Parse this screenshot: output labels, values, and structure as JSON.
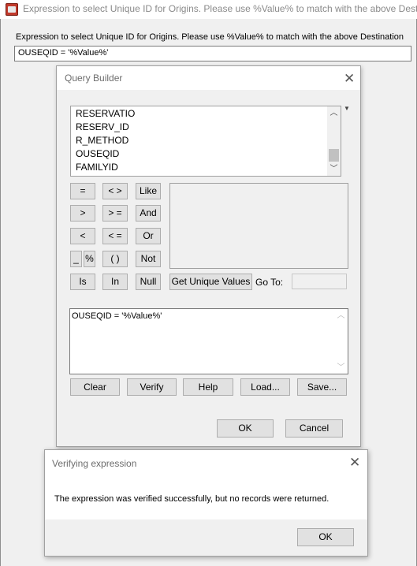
{
  "window": {
    "title": "Expression to select Unique ID for Origins.  Please use %Value% to match with the above Destin",
    "expression_label": "Expression to select Unique ID for Origins.  Please use %Value% to match with the above Destination",
    "expression_value": "OUSEQID = '%Value%'"
  },
  "query_builder": {
    "title": "Query Builder",
    "close_glyph": "✕",
    "fields": [
      "RESERVATIO",
      "RESERV_ID",
      "R_METHOD",
      "OUSEQID",
      "FAMILYID"
    ],
    "operators": {
      "eq": "=",
      "ne": "< >",
      "like": "Like",
      "gt": ">",
      "ge": "> =",
      "and": "And",
      "lt": "<",
      "le": "< =",
      "or": "Or",
      "underscore": "_",
      "percent": "%",
      "parens": "( )",
      "not": "Not",
      "is": "Is",
      "in": "In",
      "null": "Null"
    },
    "get_unique_values_label": "Get Unique Values",
    "goto_label": "Go To:",
    "goto_value": "",
    "sql_expression": "OUSEQID = '%Value%'",
    "buttons": {
      "clear": "Clear",
      "verify": "Verify",
      "help": "Help",
      "load": "Load...",
      "save": "Save...",
      "ok": "OK",
      "cancel": "Cancel"
    }
  },
  "verify_dialog": {
    "title": "Verifying expression",
    "close_glyph": "✕",
    "message": "The expression was verified successfully, but no records were returned.",
    "ok_label": "OK"
  },
  "colors": {
    "app_icon": "#c0392b",
    "button_face": "#e1e1e1",
    "dialog_bg": "#f0f0f0"
  }
}
